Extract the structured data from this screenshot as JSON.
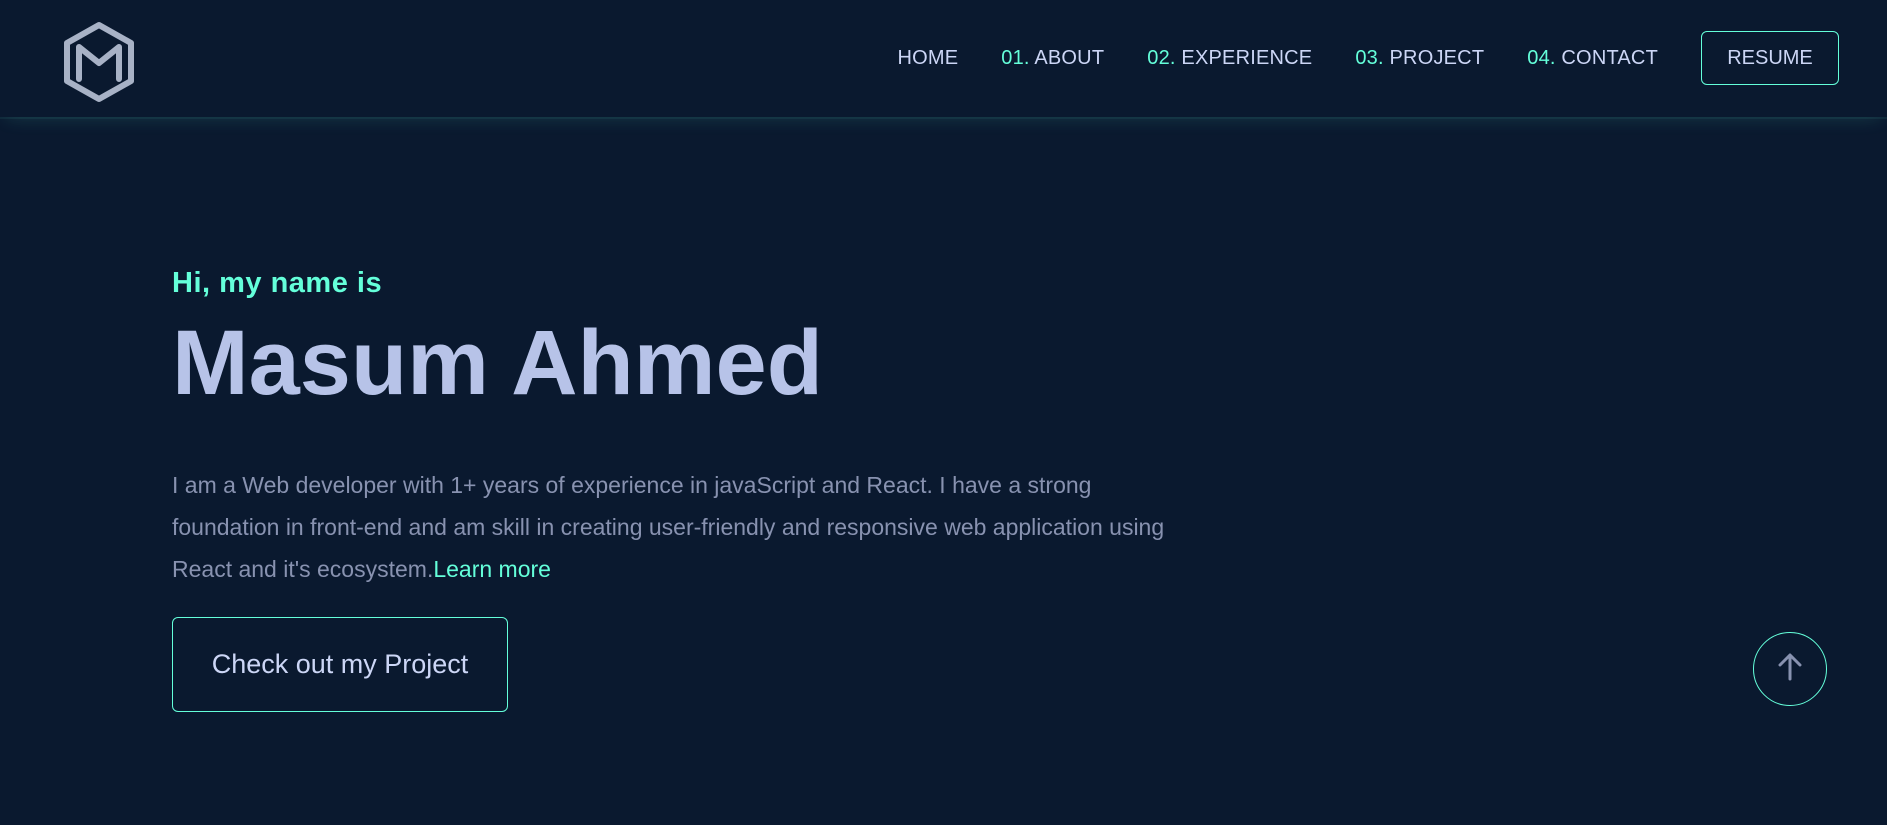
{
  "colors": {
    "background": "#0a192f",
    "accent": "#64ffda",
    "heading": "#ccd6f6",
    "text": "#8892b0"
  },
  "logo": {
    "icon": "hexagon-m-logo-icon"
  },
  "nav": {
    "home": {
      "label": "HOME"
    },
    "about": {
      "num": "01.",
      "label": " ABOUT"
    },
    "experience": {
      "num": "02.",
      "label": " EXPERIENCE"
    },
    "project": {
      "num": "03.",
      "label": " PROJECT"
    },
    "contact": {
      "num": "04.",
      "label": " CONTACT"
    },
    "resume_label": "RESUME"
  },
  "hero": {
    "greeting": "Hi, my name is",
    "name": "Masum Ahmed",
    "bio": "I am a Web developer with 1+ years of experience in javaScript and React. I have a strong foundation in front-end and am skill in creating user-friendly and responsive web application using React and it's ecosystem.",
    "learn_more": "Learn more",
    "cta_label": "Check out my Project"
  },
  "scroll_top": {
    "icon": "arrow-up-icon"
  }
}
